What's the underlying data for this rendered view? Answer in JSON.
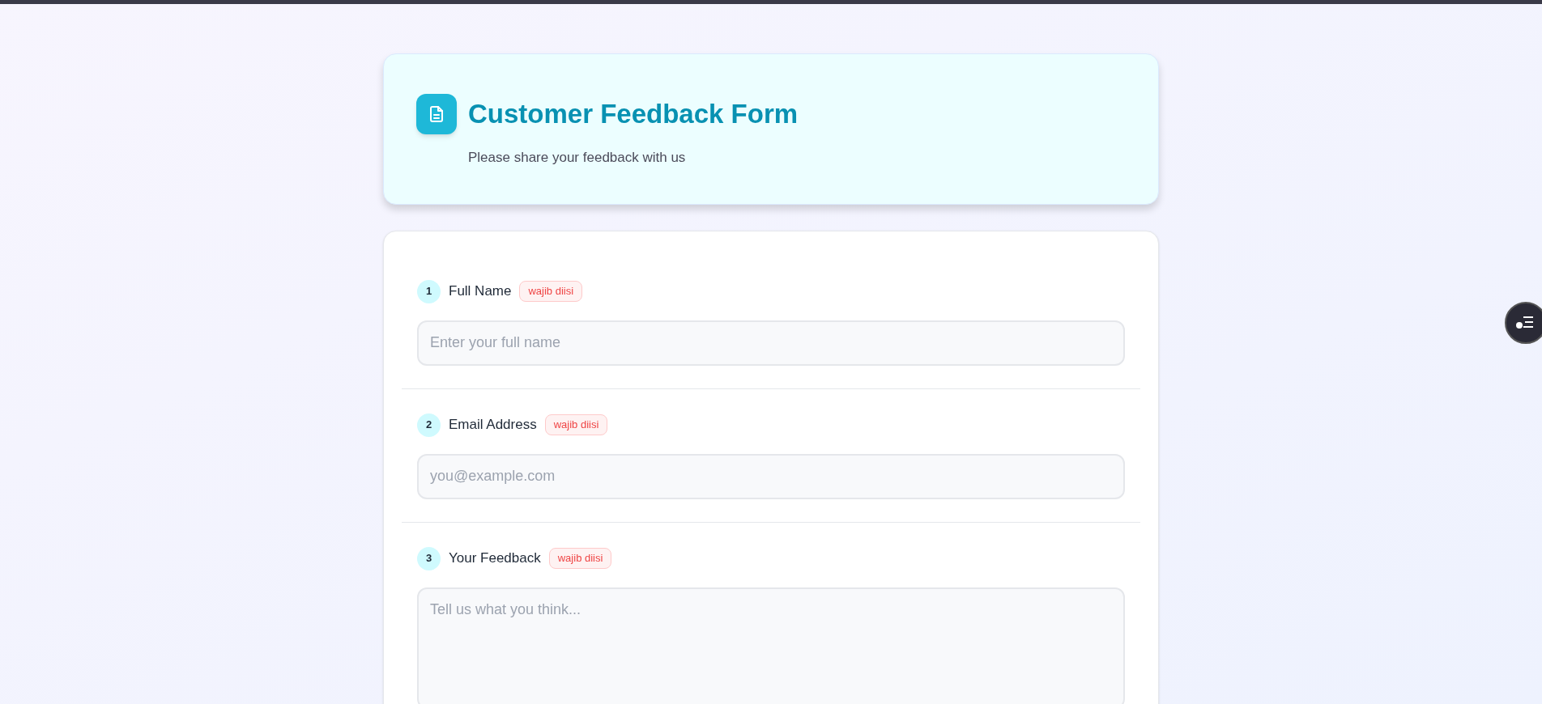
{
  "header": {
    "title": "Customer Feedback Form",
    "subtitle": "Please share your feedback with us"
  },
  "fields": [
    {
      "number": "1",
      "label": "Full Name",
      "badge": "wajib diisi",
      "kind": "input",
      "placeholder": "Enter your full name"
    },
    {
      "number": "2",
      "label": "Email Address",
      "badge": "wajib diisi",
      "kind": "input",
      "placeholder": "you@example.com"
    },
    {
      "number": "3",
      "label": "Your Feedback",
      "badge": "wajib diisi",
      "kind": "textarea",
      "placeholder": "Tell us what you think..."
    }
  ]
}
